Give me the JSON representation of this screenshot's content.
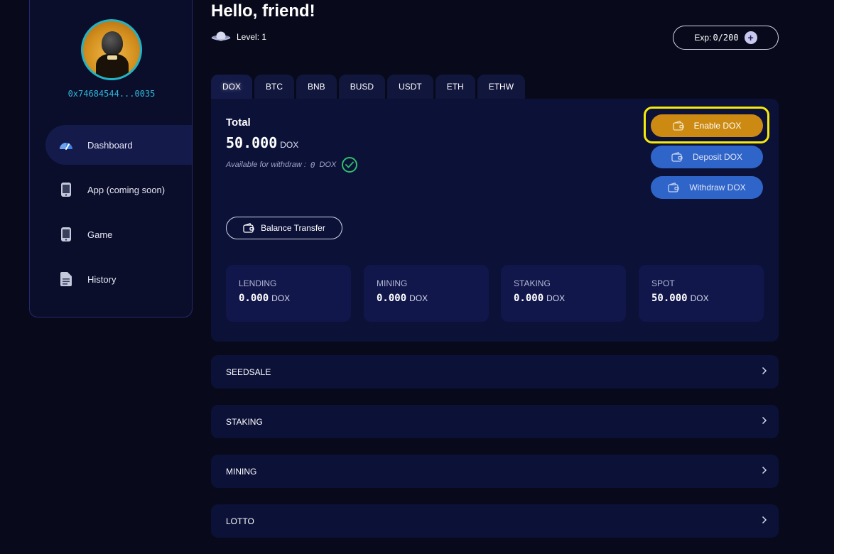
{
  "user": {
    "wallet_address": "0x74684544...0035"
  },
  "sidebar": {
    "items": [
      {
        "label": "Dashboard",
        "icon": "speedometer-icon"
      },
      {
        "label": "App (coming soon)",
        "icon": "phone-icon"
      },
      {
        "label": "Game",
        "icon": "phone-icon"
      },
      {
        "label": "History",
        "icon": "document-icon"
      }
    ]
  },
  "header": {
    "greeting": "Hello, friend!",
    "level_label": "Level: 1",
    "exp_label": "Exp:",
    "exp_value": "0/200",
    "exp_plus": "+"
  },
  "tabs": [
    "DOX",
    "BTC",
    "BNB",
    "BUSD",
    "USDT",
    "ETH",
    "ETHW"
  ],
  "active_tab": "DOX",
  "balance": {
    "total_label": "Total",
    "total_value": "50.000",
    "unit": "DOX",
    "available_label": "Available for withdraw :",
    "available_value": "0",
    "available_unit": "DOX"
  },
  "actions": {
    "enable": "Enable DOX",
    "deposit": "Deposit DOX",
    "withdraw": "Withdraw DOX",
    "transfer": "Balance Transfer"
  },
  "stats": [
    {
      "label": "LENDING",
      "value": "0.000",
      "unit": "DOX"
    },
    {
      "label": "MINING",
      "value": "0.000",
      "unit": "DOX"
    },
    {
      "label": "STAKING",
      "value": "0.000",
      "unit": "DOX"
    },
    {
      "label": "SPOT",
      "value": "50.000",
      "unit": "DOX"
    }
  ],
  "sections": [
    "SEEDSALE",
    "STAKING",
    "MINING",
    "LOTTO"
  ],
  "colors": {
    "background": "#080a1c",
    "card": "#0c1138",
    "accent_gold": "#cc8a12",
    "accent_blue": "#2f65c9",
    "wallet_cyan": "#2fb5d9",
    "highlight_yellow": "#f6ea0d",
    "success_green": "#2fbf6b"
  }
}
